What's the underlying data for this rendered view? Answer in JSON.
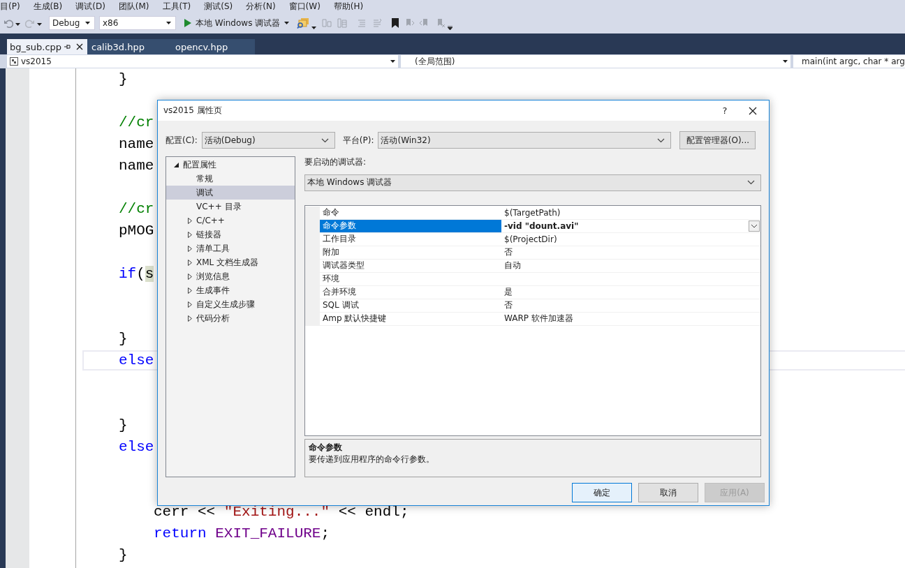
{
  "menu": [
    {
      "label": "目(P)"
    },
    {
      "label": "生成(B)"
    },
    {
      "label": "调试(D)"
    },
    {
      "label": "团队(M)"
    },
    {
      "label": "工具(T)"
    },
    {
      "label": "测试(S)"
    },
    {
      "label": "分析(N)"
    },
    {
      "label": "窗口(W)"
    },
    {
      "label": "帮助(H)"
    }
  ],
  "toolbar": {
    "configuration": "Debug",
    "platform": "x86",
    "start_button": "本地 Windows 调试器"
  },
  "tabs": [
    {
      "label": "bg_sub.cpp",
      "selected": true
    },
    {
      "label": "calib3d.hpp",
      "selected": false
    },
    {
      "label": "opencv.hpp",
      "selected": false
    }
  ],
  "navigation": {
    "project": "vs2015",
    "scope": "(全局范围)",
    "member": "main(int argc, char * arg"
  },
  "code_lines": [
    {
      "kind": "outer",
      "tokens": [
        {
          "kind": "plain",
          "text": "}"
        }
      ]
    },
    {
      "kind": "blank"
    },
    {
      "kind": "outer",
      "tokens": [
        {
          "kind": "comment",
          "text": "//cr"
        }
      ]
    },
    {
      "kind": "outer",
      "tokens": [
        {
          "kind": "plain",
          "text": "name"
        }
      ]
    },
    {
      "kind": "outer",
      "tokens": [
        {
          "kind": "plain",
          "text": "name"
        }
      ]
    },
    {
      "kind": "blank"
    },
    {
      "kind": "outer",
      "tokens": [
        {
          "kind": "comment",
          "text": "//cr"
        }
      ]
    },
    {
      "kind": "outer",
      "tokens": [
        {
          "kind": "plain",
          "text": "pMOG"
        }
      ]
    },
    {
      "kind": "blank"
    },
    {
      "kind": "outer",
      "tokens": [
        {
          "kind": "keyword",
          "text": "if"
        },
        {
          "kind": "plain",
          "text": "("
        },
        {
          "kind": "highlight",
          "text": "s"
        }
      ]
    },
    {
      "kind": "blank"
    },
    {
      "kind": "blank"
    },
    {
      "kind": "outer",
      "tokens": [
        {
          "kind": "plain",
          "text": "}"
        }
      ]
    },
    {
      "kind": "outer",
      "current": true,
      "tokens": [
        {
          "kind": "keyword",
          "text": "else"
        }
      ]
    },
    {
      "kind": "blank"
    },
    {
      "kind": "blank"
    },
    {
      "kind": "outer",
      "tokens": [
        {
          "kind": "plain",
          "text": "}"
        }
      ]
    },
    {
      "kind": "outer",
      "tokens": [
        {
          "kind": "keyword",
          "text": "else"
        }
      ]
    },
    {
      "kind": "blank"
    },
    {
      "kind": "blank"
    },
    {
      "kind": "inner",
      "tokens": [
        {
          "kind": "plain",
          "text": "cerr << "
        },
        {
          "kind": "string",
          "text": "\"Exiting...\""
        },
        {
          "kind": "plain",
          "text": " << endl;"
        }
      ]
    },
    {
      "kind": "inner",
      "tokens": [
        {
          "kind": "keyword",
          "text": "return "
        },
        {
          "kind": "macro",
          "text": "EXIT_FAILURE"
        },
        {
          "kind": "plain",
          "text": ";"
        }
      ]
    },
    {
      "kind": "outer",
      "tokens": [
        {
          "kind": "plain",
          "text": "}"
        }
      ]
    }
  ],
  "dialog": {
    "title": "vs2015 属性页",
    "help_button": "?",
    "configuration_label": "配置(C):",
    "configuration": "活动(Debug)",
    "platform_label": "平台(P):",
    "platform": "活动(Win32)",
    "manager_button": "配置管理器(O)...",
    "tree": [
      {
        "label": "配置属性",
        "expanded": true,
        "selected": false,
        "children": [
          {
            "label": "常规",
            "selected": false
          },
          {
            "label": "调试",
            "selected": true
          },
          {
            "label": "VC++ 目录",
            "selected": false
          },
          {
            "label": "C/C++",
            "expanded": false,
            "selected": false
          },
          {
            "label": "链接器",
            "expanded": false,
            "selected": false
          },
          {
            "label": "清单工具",
            "expanded": false,
            "selected": false
          },
          {
            "label": "XML 文档生成器",
            "expanded": false,
            "selected": false
          },
          {
            "label": "浏览信息",
            "expanded": false,
            "selected": false
          },
          {
            "label": "生成事件",
            "expanded": false,
            "selected": false
          },
          {
            "label": "自定义生成步骤",
            "expanded": false,
            "selected": false
          },
          {
            "label": "代码分析",
            "expanded": false,
            "selected": false
          }
        ]
      }
    ],
    "debugger_label": "要启动的调试器:",
    "debugger": "本地 Windows 调试器",
    "properties": [
      {
        "name": "命令",
        "value": "$(TargetPath)",
        "selected": false
      },
      {
        "name": "命令参数",
        "value": "-vid \"dount.avi\"",
        "selected": true
      },
      {
        "name": "工作目录",
        "value": "$(ProjectDir)",
        "selected": false
      },
      {
        "name": "附加",
        "value": "否",
        "selected": false
      },
      {
        "name": "调试器类型",
        "value": "自动",
        "selected": false
      },
      {
        "name": "环境",
        "selected": false
      },
      {
        "name": "合并环境",
        "value": "是",
        "selected": false
      },
      {
        "name": "SQL 调试",
        "value": "否",
        "selected": false
      },
      {
        "name": "Amp 默认快捷键",
        "value": "WARP 软件加速器",
        "selected": false
      }
    ],
    "description": {
      "title": "命令参数",
      "text": "要传递到应用程序的命令行参数。"
    },
    "buttons": [
      {
        "label": "确定",
        "default": true,
        "disabled": false
      },
      {
        "label": "取消",
        "default": false,
        "disabled": false
      },
      {
        "label": "应用(A)",
        "default": false,
        "disabled": true
      }
    ]
  }
}
